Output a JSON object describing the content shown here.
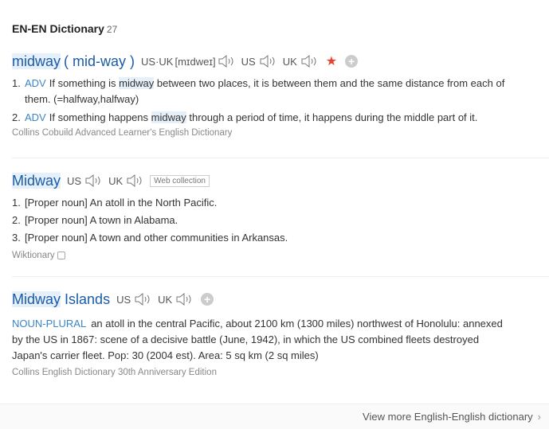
{
  "header": {
    "title": "EN-EN Dictionary",
    "count": "27"
  },
  "entry1": {
    "headword": "midway",
    "variant": "( mid-way )",
    "pron_label": "US·UK",
    "pron_text": "[mɪdweɪ]",
    "us_label": "US",
    "uk_label": "UK",
    "definitions": [
      {
        "num": "1.",
        "pos": "ADV",
        "pre": "If something is ",
        "hl": "midway",
        "post": " between two places, it is between them and the same distance from each of",
        "cont": "them. (=halfway,halfway)"
      },
      {
        "num": "2.",
        "pos": "ADV",
        "pre": "If something happens ",
        "hl": "midway",
        "post": " through a period of time, it happens during the middle part of it."
      }
    ],
    "source": "Collins Cobuild Advanced Learner's English Dictionary"
  },
  "entry2": {
    "headword": "Midway",
    "us_label": "US",
    "uk_label": "UK",
    "tag": "Web collection",
    "definitions": [
      {
        "num": "1.",
        "text": "[Proper noun] An atoll in the North Pacific."
      },
      {
        "num": "2.",
        "text": "[Proper noun] A town in Alabama."
      },
      {
        "num": "3.",
        "text": "[Proper noun] A town and other communities in Arkansas."
      }
    ],
    "source": "Wiktionary"
  },
  "entry3": {
    "headword_hl": "Midway",
    "headword_rest": "Islands",
    "us_label": "US",
    "uk_label": "UK",
    "pos": "NOUN-PLURAL",
    "line1": "an atoll in the central Pacific, about 2100 km (1300 miles) northwest of Honolulu: annexed",
    "line2": "by the US in 1867: scene of a decisive battle (June, 1942), in which the US combined fleets destroyed",
    "line3": "Japan's carrier fleet. Pop: 30 (2004 est). Area: 5 sq km (2 sq miles)",
    "source": "Collins English Dictionary 30th Anniversary Edition"
  },
  "footer": {
    "link": "View more English-English dictionary"
  }
}
